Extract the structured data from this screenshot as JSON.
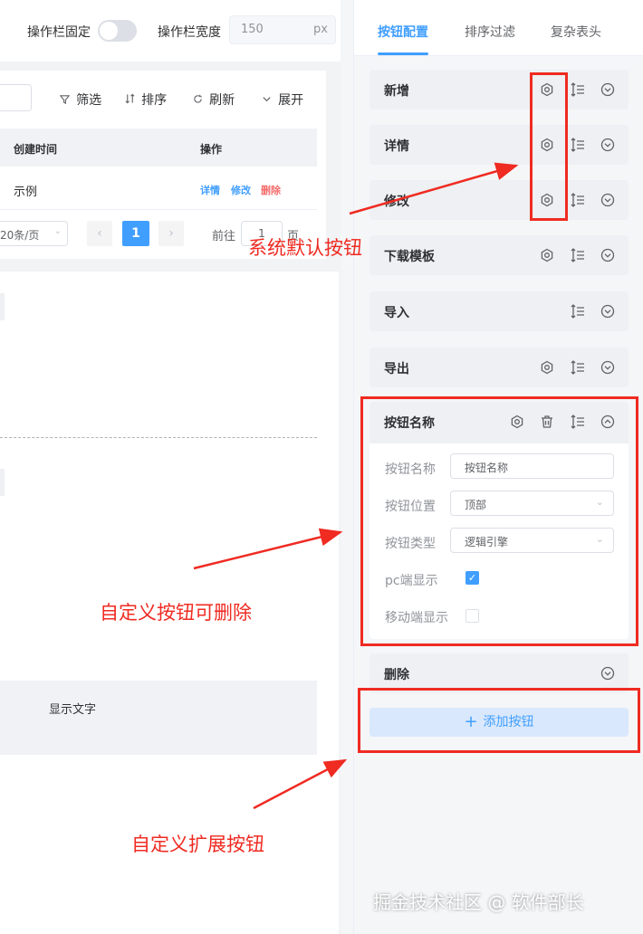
{
  "topbar": {
    "fixed_label": "操作栏固定",
    "width_label": "操作栏宽度",
    "width_value": "150",
    "width_unit": "px"
  },
  "preview": {
    "tools": [
      {
        "icon": "filter-icon",
        "label": "筛选"
      },
      {
        "icon": "sort-icon",
        "label": "排序"
      },
      {
        "icon": "refresh-icon",
        "label": "刷新"
      },
      {
        "icon": "chevron-down-icon",
        "label": "展开"
      }
    ],
    "table": {
      "columns": [
        "创建时间",
        "操作"
      ],
      "rows": [
        {
          "created": "示例",
          "actions": [
            "详情",
            "修改",
            "删除"
          ]
        }
      ]
    },
    "pager": {
      "page_size": "20条/页",
      "current_page": "1",
      "goto_label": "前往",
      "goto_value": "1",
      "page_unit": "页"
    },
    "text_block_label": "显示文字"
  },
  "panel": {
    "tabs": [
      "按钮配置",
      "排序过滤",
      "复杂表头"
    ],
    "active_tab": "按钮配置",
    "buttons": [
      {
        "name": "新增",
        "icons": [
          "settings-icon",
          "sort-lines-icon",
          "chevron-down-circle-icon"
        ]
      },
      {
        "name": "详情",
        "icons": [
          "settings-icon",
          "sort-lines-icon",
          "chevron-down-circle-icon"
        ]
      },
      {
        "name": "修改",
        "icons": [
          "settings-icon",
          "sort-lines-icon",
          "chevron-down-circle-icon"
        ]
      },
      {
        "name": "下载模板",
        "icons": [
          "settings-icon",
          "sort-lines-icon",
          "chevron-down-circle-icon"
        ]
      },
      {
        "name": "导入",
        "icons": [
          "sort-lines-icon",
          "chevron-down-circle-icon"
        ]
      },
      {
        "name": "导出",
        "icons": [
          "settings-icon",
          "sort-lines-icon",
          "chevron-down-circle-icon"
        ]
      }
    ],
    "expanded": {
      "title": "按钮名称",
      "icons": [
        "settings-icon",
        "trash-icon",
        "sort-lines-icon",
        "chevron-up-circle-icon"
      ],
      "form": {
        "name_label": "按钮名称",
        "name_value": "按钮名称",
        "position_label": "按钮位置",
        "position_value": "顶部",
        "type_label": "按钮类型",
        "type_value": "逻辑引擎",
        "pc_label": "pc端显示",
        "pc_checked": true,
        "mobile_label": "移动端显示",
        "mobile_checked": false
      }
    },
    "delete_card": "删除",
    "add_button": "添加按钮"
  },
  "annotations": {
    "system_default": "系统默认按钮",
    "custom_deletable": "自定义按钮可删除",
    "custom_extend": "自定义扩展按钮"
  },
  "watermark": "掘金技术社区 @ 软件部长",
  "colors": {
    "accent": "#409eff",
    "danger": "#f56c6c",
    "annotation": "#ef2b22",
    "card_bg": "#eef0f3"
  }
}
